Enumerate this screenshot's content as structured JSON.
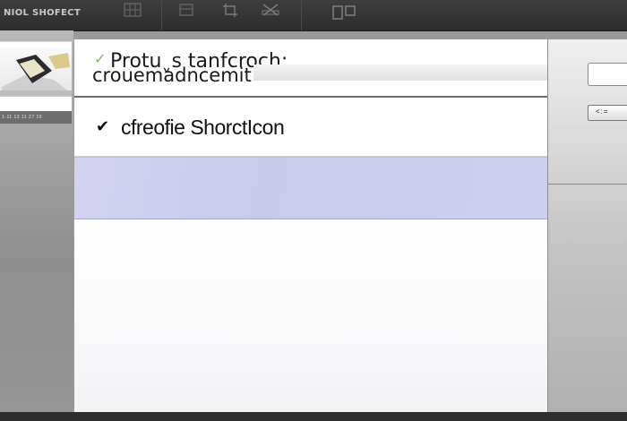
{
  "app": {
    "title": "NIOL SHOFECT"
  },
  "toolbar": {
    "buttons": [
      {
        "icon": "grid-icon",
        "label": ""
      },
      {
        "icon": "frame-icon",
        "label": ""
      },
      {
        "icon": "crop-icon",
        "label": ""
      },
      {
        "icon": "tools-icon",
        "label": ""
      },
      {
        "icon": "window-panels-icon",
        "label": ""
      }
    ]
  },
  "sidebar": {
    "thumbnail_caption": "1-11 13 11 27 10"
  },
  "dialog": {
    "header_line1": "Protuˬs tanfcroch;",
    "header_line2": "crouemadncemit",
    "items": [
      {
        "label": "cfreofie ShorctIcon",
        "checked": true,
        "selected": false
      },
      {
        "label": "",
        "checked": false,
        "selected": true
      }
    ]
  },
  "right_panel": {
    "input_value": "",
    "button_label": "<:="
  },
  "colors": {
    "selection": "#cfcfef",
    "toolbar": "#333333",
    "check_faint": "#6fbf4f"
  }
}
